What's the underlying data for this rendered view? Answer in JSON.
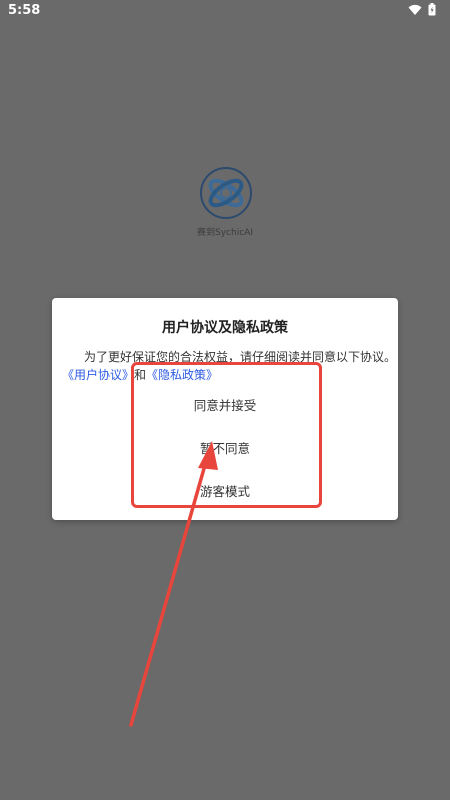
{
  "status_bar": {
    "time": "5:58"
  },
  "app": {
    "name": "赛到SychicAI"
  },
  "dialog": {
    "title": "用户协议及隐私政策",
    "body": "为了更好保证您的合法权益，请仔细阅读并同意以下协议。",
    "link_user_agreement": "《用户协议》",
    "link_conjunction": "和",
    "link_privacy_policy": "《隐私政策》",
    "buttons": {
      "accept": "同意并接受",
      "decline": "暂不同意",
      "guest": "游客模式"
    }
  },
  "colors": {
    "overlay_background": "#6a6a6a",
    "annotation": "#e8453c",
    "link": "#2d5be3"
  }
}
